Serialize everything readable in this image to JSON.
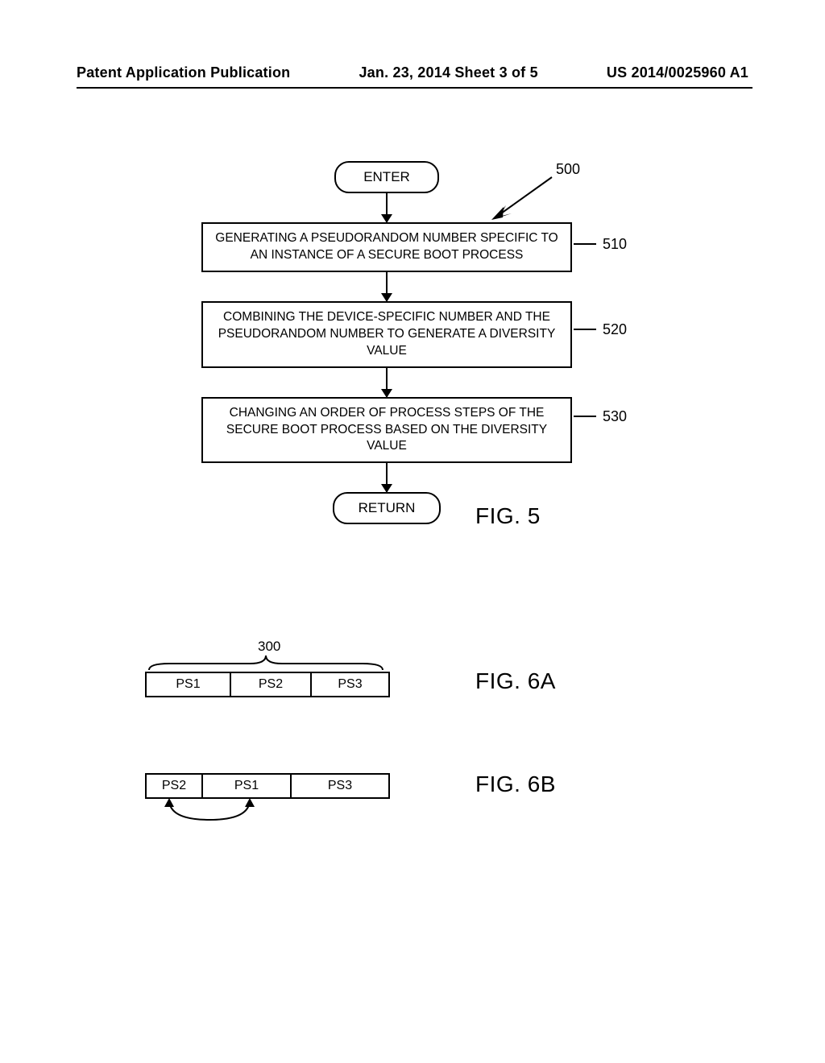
{
  "header": {
    "left": "Patent Application Publication",
    "center": "Jan. 23, 2014  Sheet 3 of 5",
    "right": "US 2014/0025960 A1"
  },
  "fig5": {
    "ref": "500",
    "enter": "ENTER",
    "step1": {
      "text": "GENERATING A PSEUDORANDOM NUMBER SPECIFIC TO AN INSTANCE OF A SECURE BOOT PROCESS",
      "ref": "510"
    },
    "step2": {
      "text": "COMBINING THE DEVICE-SPECIFIC NUMBER AND THE PSEUDORANDOM NUMBER TO GENERATE A DIVERSITY VALUE",
      "ref": "520"
    },
    "step3": {
      "text": "CHANGING AN ORDER OF PROCESS STEPS OF THE SECURE BOOT PROCESS BASED ON THE DIVERSITY VALUE",
      "ref": "530"
    },
    "return": "RETURN",
    "label": "FIG. 5"
  },
  "fig6a": {
    "ref": "300",
    "cells": [
      "PS1",
      "PS2",
      "PS3"
    ],
    "label": "FIG. 6A"
  },
  "fig6b": {
    "cells": [
      "PS2",
      "PS1",
      "PS3"
    ],
    "label": "FIG. 6B"
  }
}
